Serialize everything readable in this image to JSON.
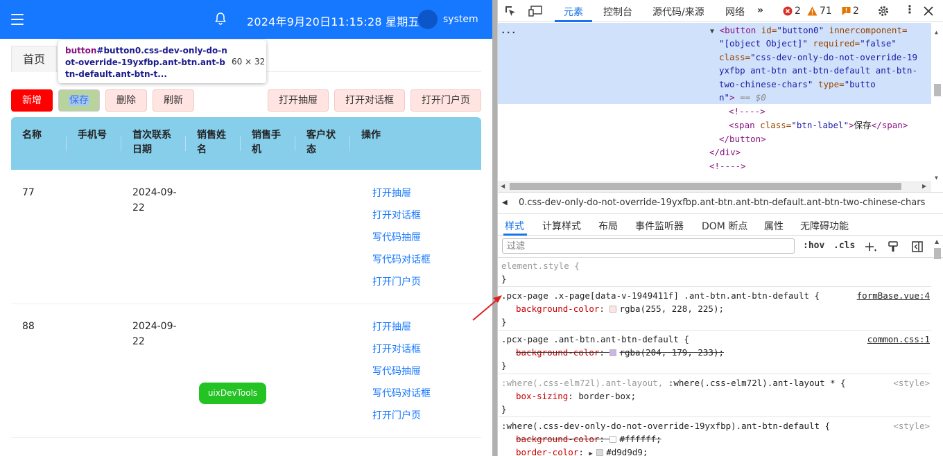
{
  "header": {
    "datetime": "2024年9月20日11:15:28 星期五",
    "username": "system"
  },
  "tabs": {
    "home": "首页"
  },
  "tooltip": {
    "tag": "button",
    "selector_rest": "#button0.css-dev-only-do-not-override-19yxfbp.ant-btn.ant-btn-default.ant-btn-t...",
    "size": "60 × 32"
  },
  "toolbar": {
    "add": "新增",
    "save": "保存",
    "delete": "删除",
    "refresh": "刷新",
    "open_drawer": "打开抽屉",
    "open_dialog": "打开对话框",
    "open_portal": "打开门户页"
  },
  "table": {
    "columns": [
      "名称",
      "手机号",
      "首次联系",
      "日期",
      "销售姓",
      "名",
      "销售手",
      "机",
      "客户状",
      "态",
      "操作"
    ],
    "rows": [
      {
        "name": "77",
        "date_line1": "2024-09-",
        "date_line2": "22",
        "actions": [
          "打开抽屉",
          "打开对话框",
          "写代码抽屉",
          "写代码对话框",
          "打开门户页"
        ]
      },
      {
        "name": "88",
        "date_line1": "2024-09-",
        "date_line2": "22",
        "actions": [
          "打开抽屉",
          "打开对话框",
          "写代码抽屉",
          "写代码对话框",
          "打开门户页"
        ]
      }
    ]
  },
  "floating_button": "uixDevTools",
  "devtools": {
    "tabs": [
      "元素",
      "控制台",
      "源代码/来源",
      "网络"
    ],
    "errors": "2",
    "warnings": "71",
    "issues": "2",
    "dom": {
      "ellipsis": "...",
      "l1_tag": "<button",
      "l1_a1": " id=",
      "l1_v1": "\"button0\"",
      "l1_a2": " innercomponent=",
      "l2_v2": "\"[object Object]\"",
      "l2_a3": " required=",
      "l2_v3": "\"false\"",
      "l3_a4": "class=",
      "l3_v4": "\"css-dev-only-do-not-override-19",
      "l4_v4": "yxfbp ant-btn ant-btn-default ant-btn-",
      "l5_v4": "two-chinese-chars\"",
      "l5_a5": " type=",
      "l5_v5": "\"butto",
      "l6_v5": "n\"",
      "l6_tag": ">",
      "l6_eq": " == $0",
      "comment": "<!---->",
      "span_open": "<span",
      "span_attr": " class=",
      "span_val": "\"btn-label\"",
      "span_gt": ">",
      "span_text": "保存",
      "span_close": "</span>",
      "button_close": "</button>",
      "div_close": "</div>",
      "comment2": "<!---->"
    },
    "breadcrumb": "0.css-dev-only-do-not-override-19yxfbp.ant-btn.ant-btn-default.ant-btn-two-chinese-chars",
    "style_tabs": [
      "样式",
      "计算样式",
      "布局",
      "事件监听器",
      "DOM 断点",
      "属性",
      "无障碍功能"
    ],
    "filter_placeholder": "过滤",
    "hov": ":hov",
    "cls": ".cls",
    "rules": [
      {
        "selector": "element.style {",
        "close": "}"
      },
      {
        "selector": ".pcx-page .x-page[data-v-1949411f] .ant-btn.ant-btn-default {",
        "source": "formBase.vue:4",
        "prop": "background-color",
        "value": "rgba(255, 228, 225);",
        "swatch": "#ffe4e1",
        "close": "}"
      },
      {
        "selector": ".pcx-page .ant-btn.ant-btn-default {",
        "source": "common.css:1",
        "prop": "background-color",
        "value": "rgba(204, 179, 233);",
        "swatch": "#ccb3e9",
        "close": "}"
      },
      {
        "selector_dim": ":where(.css-elm72l).ant-layout,",
        "selector": " :where(.css-elm72l).ant-layout * {",
        "source": "<style>",
        "prop": "box-sizing",
        "value": "border-box;",
        "close": "}"
      },
      {
        "selector": ":where(.css-dev-only-do-not-override-19yxfbp).ant-btn-default {",
        "source": "<style>",
        "prop": "background-color",
        "value": "#ffffff;",
        "swatch": "#ffffff",
        "prop2": "border-color",
        "value2": "#d9d9d9;",
        "swatch2": "#d9d9d9"
      }
    ]
  },
  "colors": {
    "topbar": "#1677ff",
    "table_header": "#87ceeb",
    "add_button": "#ff0000",
    "pink_button": "#ffe4e1",
    "float_button": "#22c322",
    "link": "#1677ff"
  }
}
